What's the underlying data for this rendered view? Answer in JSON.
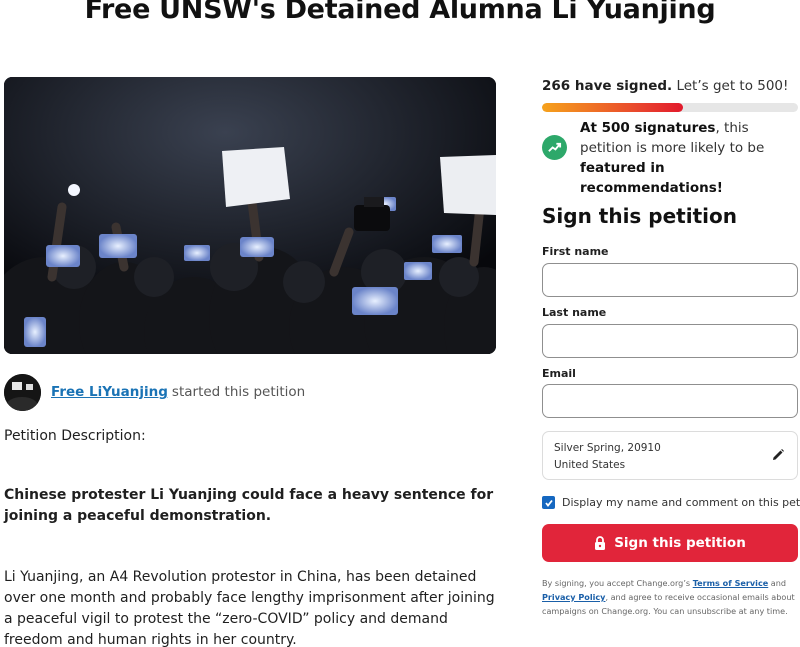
{
  "page": {
    "title": "Free UNSW's Detained Alumna Li Yuanjing"
  },
  "starter": {
    "name": "Free LiYuanjing",
    "suffix": "started this petition"
  },
  "description": {
    "label": "Petition Description:",
    "lead": "Chinese protester Li Yuanjing could face a heavy sentence for joining a peaceful demonstration.",
    "body": "Li Yuanjing, an A4 Revolution protestor in China, has been detained over one month and probably face lengthy imprisonment after joining a peaceful vigil to protest the “zero-COVID” policy and demand freedom and human rights in her country."
  },
  "signatures": {
    "count_text": "266 have signed.",
    "goal_text": "Let’s get to 500!",
    "progress_fraction": 0.55,
    "feature_bold1": "At 500 signatures",
    "feature_mid": ", this petition is more likely to be ",
    "feature_bold2": "featured in recommendations!"
  },
  "form": {
    "heading": "Sign this petition",
    "first_name_label": "First name",
    "last_name_label": "Last name",
    "email_label": "Email",
    "location_city": "Silver Spring, 20910",
    "location_country": "United States",
    "display_checkbox_label": "Display my name and comment on this petition",
    "display_checked": true,
    "sign_button": "Sign this petition"
  },
  "legal": {
    "part1": "By signing, you accept Change.org’s ",
    "terms": "Terms of Service",
    "part2": " and ",
    "privacy": "Privacy Policy",
    "part3": ", and agree to receive occasional emails about campaigns on Change.org. You can unsubscribe at any time."
  },
  "colors": {
    "accent_red": "#e1253a",
    "link_blue": "#1a73b5",
    "trend_green": "#2da86a",
    "checkbox_blue": "#1567c0"
  },
  "icons": [
    "trending-up-icon",
    "pencil-icon",
    "lock-icon",
    "check-icon"
  ]
}
